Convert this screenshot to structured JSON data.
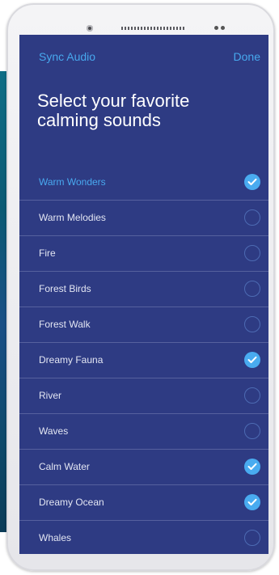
{
  "nav": {
    "left_label": "Sync Audio",
    "right_label": "Done"
  },
  "title": "Select your favorite calming sounds",
  "colors": {
    "screen_bg": "#2e3b83",
    "accent": "#47a8ee",
    "check_on": "#49abf0",
    "divider": "#56619e"
  },
  "sounds": [
    {
      "label": "Warm Wonders",
      "selected": true,
      "highlighted": true
    },
    {
      "label": "Warm Melodies",
      "selected": false,
      "highlighted": false
    },
    {
      "label": "Fire",
      "selected": false,
      "highlighted": false
    },
    {
      "label": "Forest Birds",
      "selected": false,
      "highlighted": false
    },
    {
      "label": "Forest Walk",
      "selected": false,
      "highlighted": false
    },
    {
      "label": "Dreamy Fauna",
      "selected": true,
      "highlighted": false
    },
    {
      "label": "River",
      "selected": false,
      "highlighted": false
    },
    {
      "label": "Waves",
      "selected": false,
      "highlighted": false
    },
    {
      "label": "Calm Water",
      "selected": true,
      "highlighted": false
    },
    {
      "label": "Dreamy Ocean",
      "selected": true,
      "highlighted": false
    },
    {
      "label": "Whales",
      "selected": false,
      "highlighted": false
    }
  ]
}
